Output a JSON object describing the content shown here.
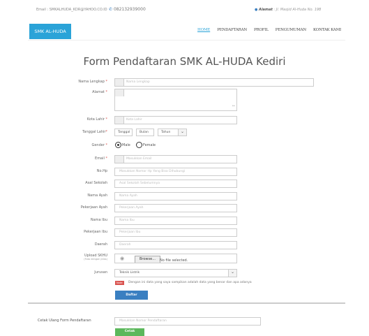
{
  "topbar": {
    "email": "Email : SMKALHUDA_KDR@YAHOO.CO.ID",
    "phone_icon": "phone-icon",
    "phone": "082132939000",
    "address_icon": "map-marker-icon",
    "address_label": "Alamat",
    "address_value": ": Jl. Masjid Al-Huda No. 19B"
  },
  "navbar": {
    "brand": "SMK AL-HUDA",
    "items": [
      "HOME",
      "PENDAFTARAN",
      "PROFIL",
      "PENGUMUMAN",
      "KONTAK KAMI"
    ],
    "active_index": 0
  },
  "form": {
    "title": "Form Pendaftaran SMK AL-HUDA Kediri",
    "required_mark": "*",
    "fields": {
      "nama_lengkap": {
        "label": "Nama Lengkap",
        "placeholder": "Nama Lengkap"
      },
      "alamat": {
        "label": "Alamat",
        "placeholder": ""
      },
      "kota_lahir": {
        "label": "Kota Lahir",
        "placeholder": "Kota Lahir"
      },
      "tanggal_lahir": {
        "label": "Tanggal Lahir",
        "tanggal": "Tanggal",
        "bulan": "Bulan",
        "tahun": "Tahun"
      },
      "gender": {
        "label": "Gender",
        "options": [
          "Male",
          "Female"
        ],
        "selected": "Male"
      },
      "email": {
        "label": "Email",
        "placeholder": "Masukkan Email"
      },
      "nohp": {
        "label": "No.Hp",
        "placeholder": "Masukkan Nomor Hp Yang Bisa Dihubungi"
      },
      "asal_sekolah": {
        "label": "Asal Sekolah",
        "placeholder": "Asal Sekolah Sebelumnya"
      },
      "nama_ayah": {
        "label": "Nama Ayah",
        "placeholder": "Nama Ayah"
      },
      "pekerjaan_ayah": {
        "label": "Pekerjaan Ayah",
        "placeholder": "Pekerjaan Ayah"
      },
      "nama_ibu": {
        "label": "Nama Ibu",
        "placeholder": "Nama Ibu"
      },
      "pekerjaan_ibu": {
        "label": "Pekerjaan Ibu",
        "placeholder": "Pekerjaan Ibu"
      },
      "daerah": {
        "label": "Daerah",
        "placeholder": "Daerah"
      },
      "upload": {
        "label": "Upload SKHU",
        "sublabel": "(Foto dengan jelas)",
        "button": "Browse...",
        "status": "No file selected."
      },
      "jurusan": {
        "label": "Jurusan",
        "value": "Teknik Listrik"
      }
    },
    "notice": {
      "badge": "Note:",
      "text": "Dengan ini data yang saya sampikan adalah data yang benar dan apa adanya"
    },
    "submit": "Daftar"
  },
  "cetak": {
    "label": "Cetak Ulang Form Pendaftaran",
    "placeholder": "Masukkan Nomor Pendaftaran",
    "button": "Cetak"
  }
}
